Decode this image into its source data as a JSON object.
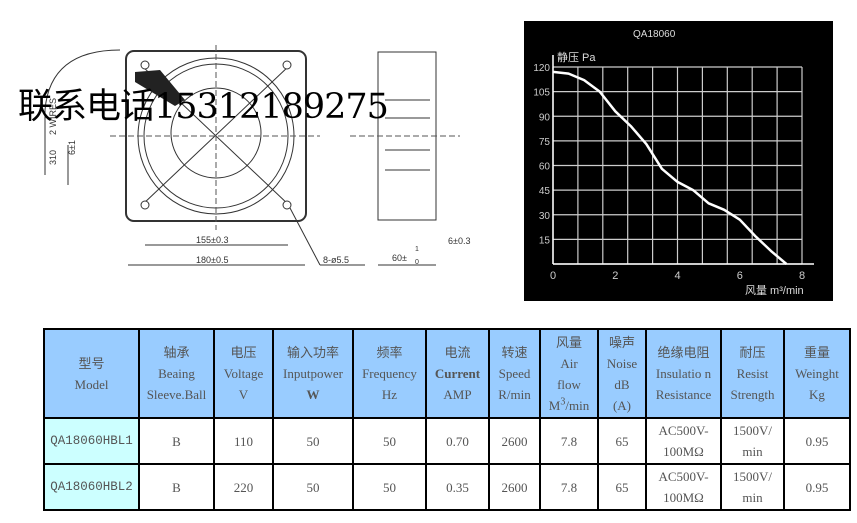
{
  "watermark": "联系电话15312189275",
  "drawing": {
    "dim_155": "155±0.3",
    "dim_180": "180±0.5",
    "dim_holes": "8-ø5.5",
    "dim_60": "60±",
    "dim_60_tol_upper": "1",
    "dim_60_tol_lower": "0",
    "dim_6": "6±0.3",
    "dim_310": "310",
    "dim_wires": "2 WIRES",
    "dim_6_1": "6±1"
  },
  "chart_data": {
    "type": "line",
    "title": "QA18060",
    "ylabel": "静压 Pa",
    "xlabel": "风量 m³/min",
    "xlim": [
      0,
      8
    ],
    "ylim": [
      0,
      120
    ],
    "xticks": [
      "0",
      "2",
      "4",
      "6",
      "8"
    ],
    "yticks": [
      "15",
      "30",
      "45",
      "60",
      "75",
      "90",
      "105",
      "120"
    ],
    "grid": true,
    "x": [
      0,
      0.5,
      1,
      1.5,
      2,
      2.5,
      3,
      3.5,
      4,
      4.5,
      5,
      5.5,
      6,
      6.5,
      7,
      7.5
    ],
    "y": [
      117,
      116,
      112,
      105,
      93,
      84,
      73,
      58,
      50,
      45,
      37,
      33,
      27,
      17,
      8,
      0
    ],
    "colors": {
      "background": "#000000",
      "line": "#ffffff"
    }
  },
  "table": {
    "headers": [
      {
        "cn": "型号",
        "en1": "Model"
      },
      {
        "cn": "轴承",
        "en1": "Beaing",
        "en2": "Sleeve.Ball"
      },
      {
        "cn": "电压",
        "en1": "Voltage",
        "en2": "V"
      },
      {
        "cn": "输入功率",
        "en1": "Inputpower",
        "en2": "W"
      },
      {
        "cn": "频率",
        "en1": "Frequency",
        "en2": "Hz"
      },
      {
        "cn": "电流",
        "en1": "Current",
        "en2": "AMP"
      },
      {
        "cn": "转速",
        "en1": "Speed",
        "en2": "R/min"
      },
      {
        "cn": "风量",
        "en1": "Air",
        "en2": "flow",
        "en3": "M",
        "sup": "3",
        "en4": "/min"
      },
      {
        "cn": "噪声",
        "en1": "Noise",
        "en2": "dB",
        "en3": "(A)"
      },
      {
        "cn": "绝缘电阻",
        "en1": "Insulatio n",
        "en2": "Resistance"
      },
      {
        "cn": "耐压",
        "en1": "Resist",
        "en2": "Strength"
      },
      {
        "cn": "重量",
        "en1": "Weinght",
        "en2": "Kg"
      }
    ],
    "rows": [
      [
        "QA18060HBL1",
        "B",
        "110",
        "50",
        "50",
        "0.70",
        "2600",
        "7.8",
        "65",
        "AC500V-",
        "100MΩ",
        "1500V/",
        "min",
        "0.95"
      ],
      [
        "QA18060HBL2",
        "B",
        "220",
        "50",
        "50",
        "0.35",
        "2600",
        "7.8",
        "65",
        "AC500V-",
        "100MΩ",
        "1500V/",
        "min",
        "0.95"
      ]
    ],
    "colors": {
      "header": "#99ccff",
      "model_col": "#ccffff"
    }
  }
}
